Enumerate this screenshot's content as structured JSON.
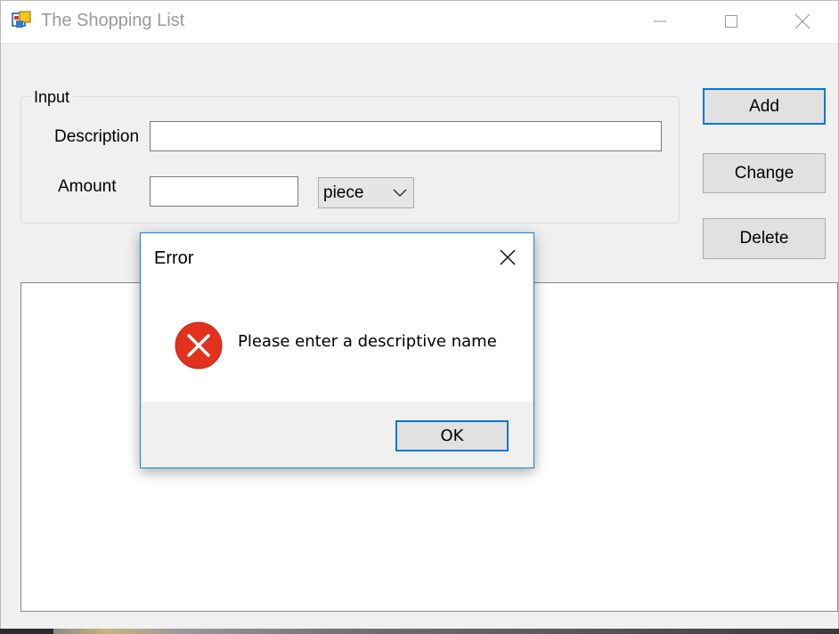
{
  "window": {
    "title": "The Shopping List",
    "app_icon": "app-icon",
    "controls": [
      "minimize-icon",
      "maximize-icon",
      "close-icon"
    ]
  },
  "input_group": {
    "legend": "Input",
    "description_label": "Description",
    "description_value": "",
    "amount_label": "Amount",
    "amount_value": "",
    "unit_selected": "piece"
  },
  "buttons": {
    "add": "Add",
    "change": "Change",
    "delete": "Delete"
  },
  "list": {
    "items": []
  },
  "dialog": {
    "title": "Error",
    "icon": "error-icon",
    "message": "Please enter a descriptive name",
    "ok_label": "OK"
  },
  "colors": {
    "accent": "#0078d7",
    "error": "#e81123",
    "window_bg": "#f0f0f0"
  }
}
